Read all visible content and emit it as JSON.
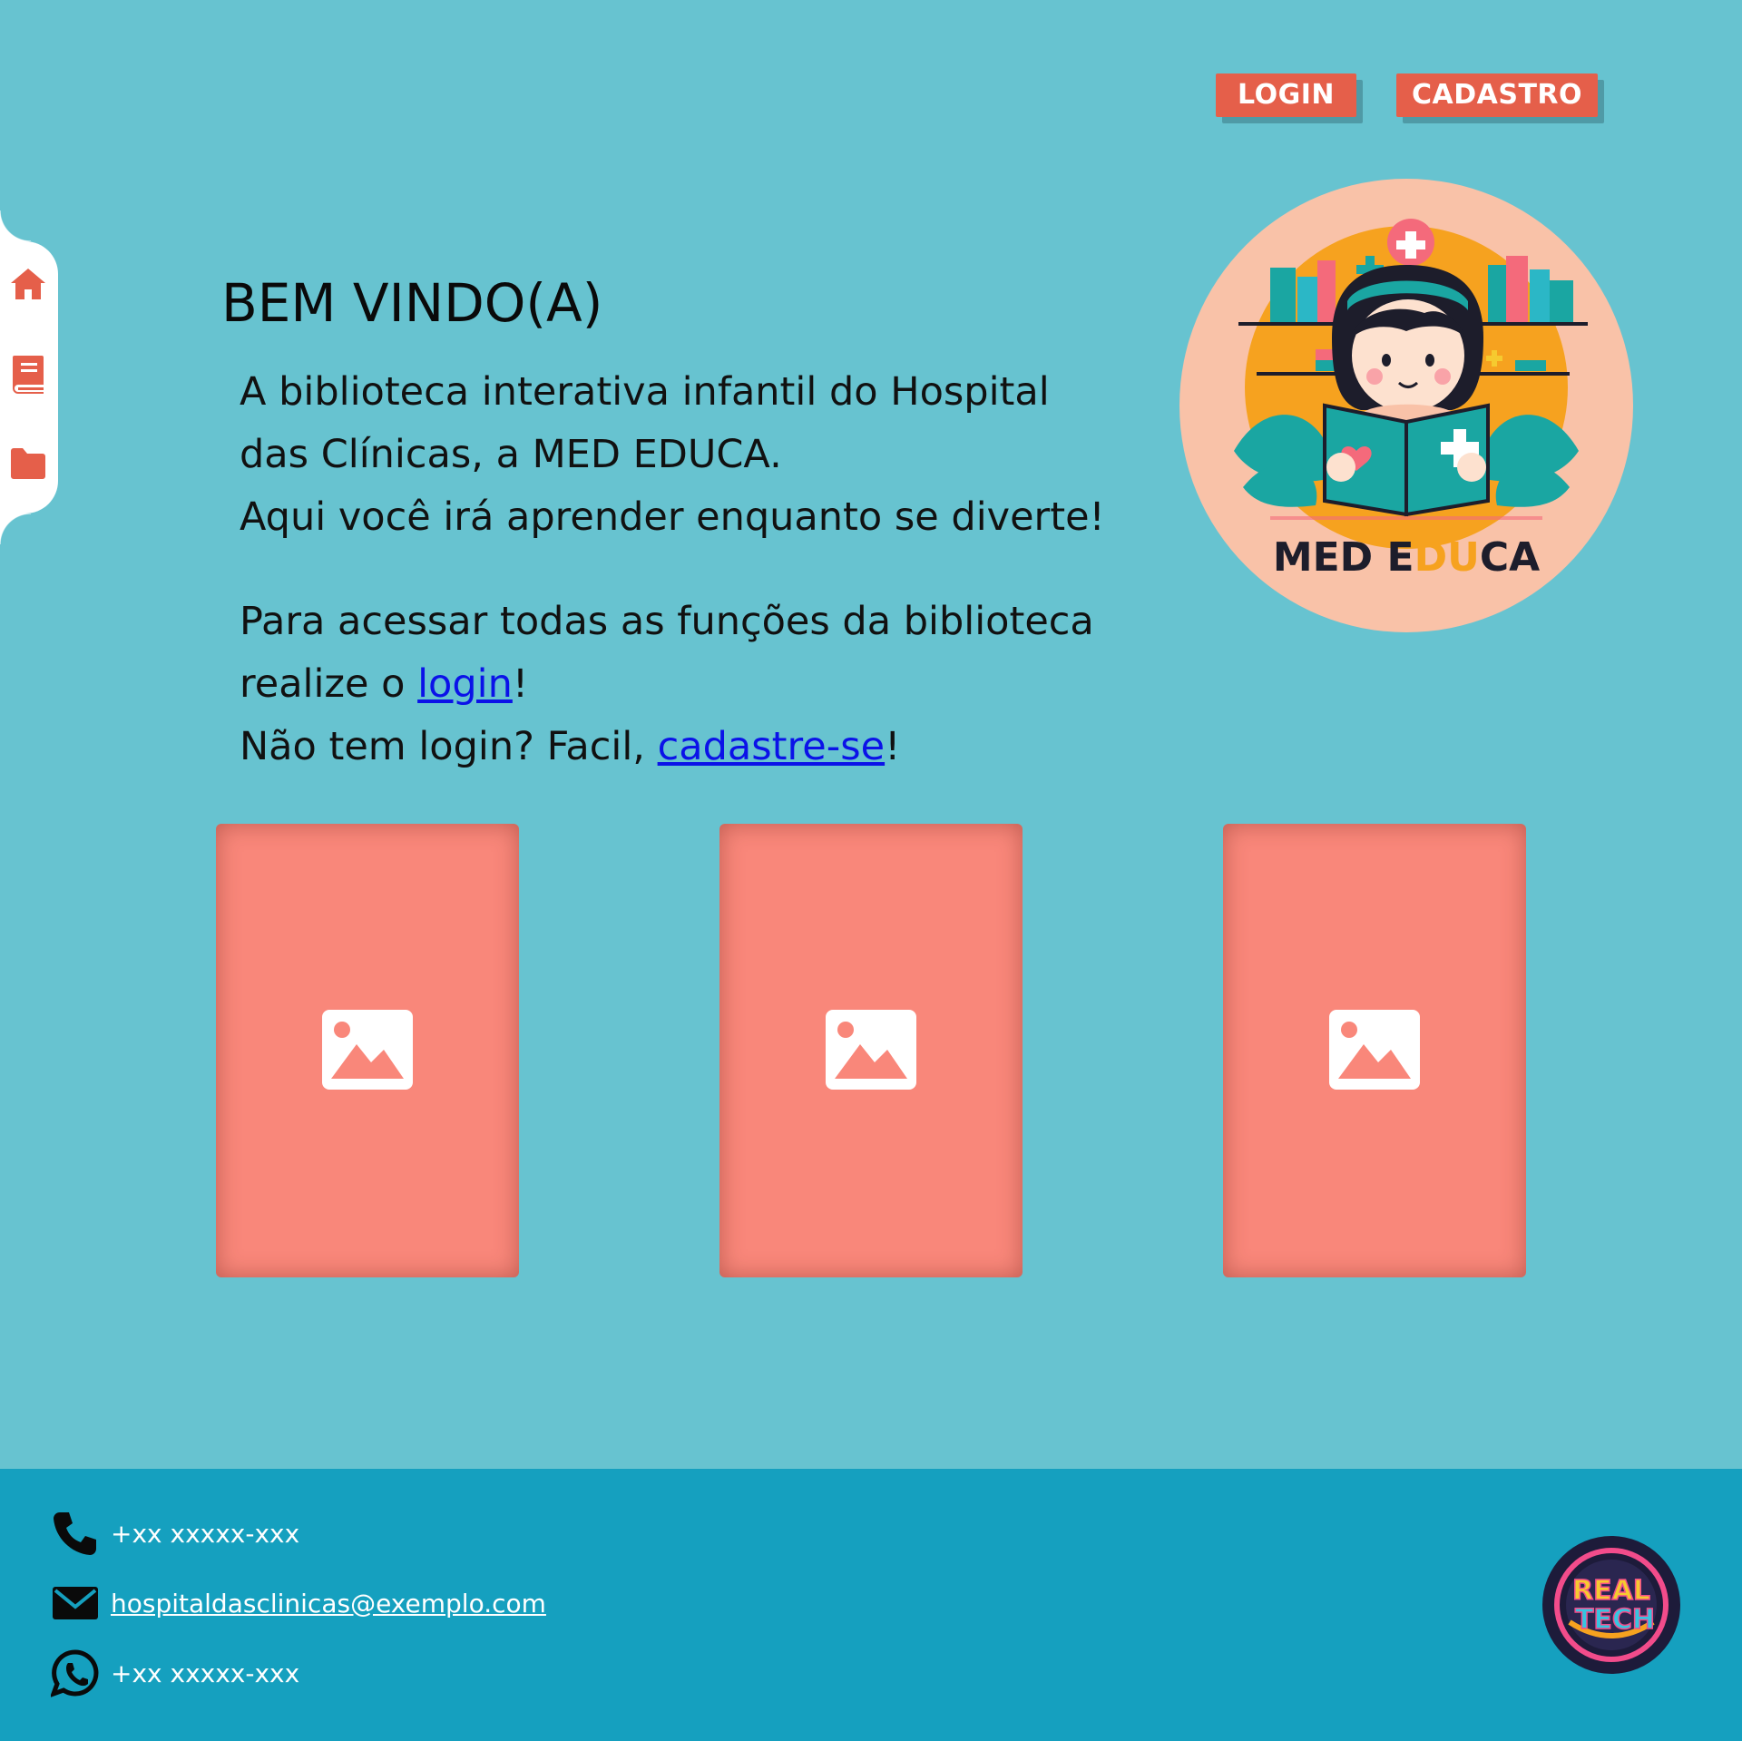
{
  "header": {
    "login_label": "LOGIN",
    "cadastro_label": "CADASTRO"
  },
  "sidebar": {
    "items": [
      {
        "icon": "home-icon"
      },
      {
        "icon": "book-icon"
      },
      {
        "icon": "folder-icon"
      }
    ]
  },
  "main": {
    "title": "BEM VINDO(A)",
    "intro_line1": "A biblioteca interativa infantil do Hospital das Clínicas, a MED EDUCA.",
    "intro_line2": "Aqui você irá aprender enquanto se diverte!",
    "access_text": "Para acessar todas as funções da biblioteca realize o ",
    "login_link": "login",
    "exclaim": "!",
    "no_login_text": "Não tem login? Facil, ",
    "signup_link": "cadastre-se"
  },
  "logo": {
    "text_med": "MED E",
    "text_du": "DU",
    "text_ca": "CA"
  },
  "cards": [
    {
      "icon": "image-placeholder-icon"
    },
    {
      "icon": "image-placeholder-icon"
    },
    {
      "icon": "image-placeholder-icon"
    }
  ],
  "footer": {
    "phone": "+xx xxxxx-xxx",
    "email": "hospitaldasclinicas@exemplo.com",
    "whatsapp": "+xx xxxxx-xxx",
    "partner_logo_line1": "REAL",
    "partner_logo_line2": "TECH"
  },
  "colors": {
    "background": "#67c3d0",
    "accent": "#e55f4a",
    "card": "#f9877a",
    "footer": "#15a0bf",
    "link": "#0b12e8"
  }
}
